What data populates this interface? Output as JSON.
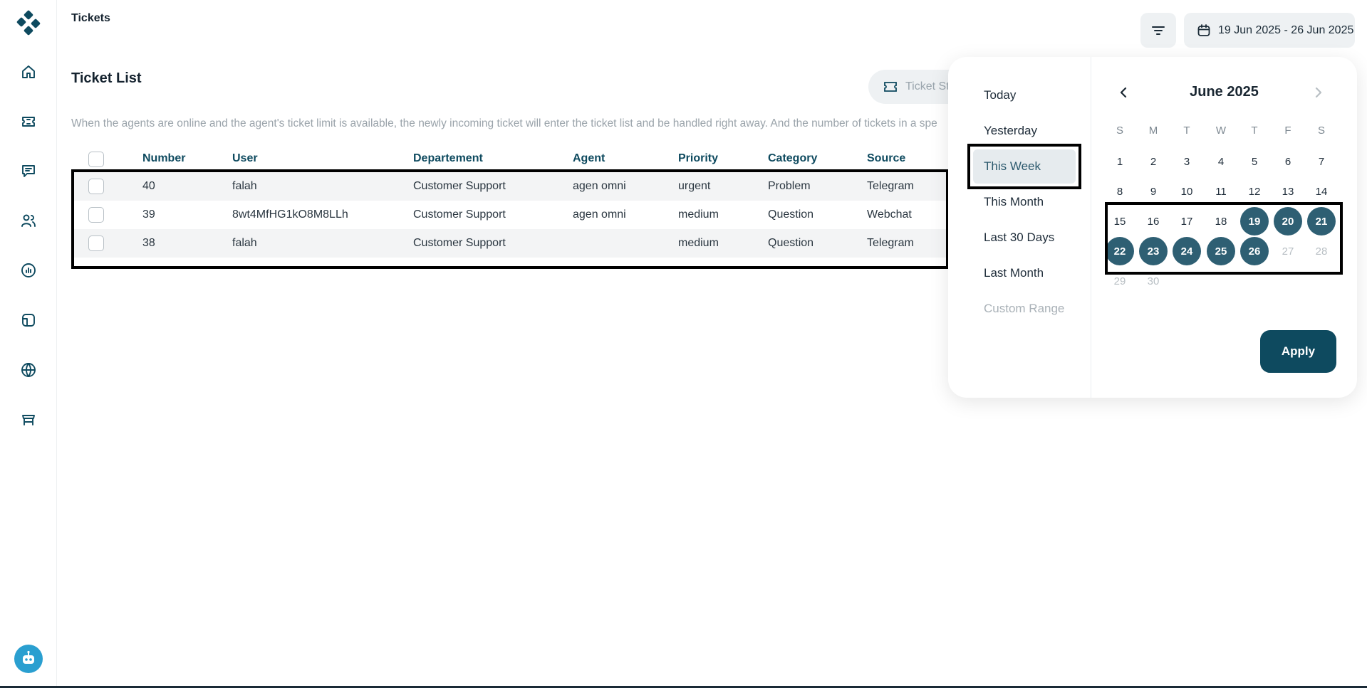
{
  "header": {
    "breadcrumb": "Tickets",
    "date_range": "19 Jun 2025 - 26 Jun 2025"
  },
  "main": {
    "title": "Ticket List",
    "ticket_status_button": "Ticket St",
    "description": "When the agents are online and the agent's ticket limit is available, the newly incoming ticket will enter the ticket list and be handled right away. And the number of tickets in a spe"
  },
  "table": {
    "columns": [
      "Number",
      "User",
      "Departement",
      "Agent",
      "Priority",
      "Category",
      "Source"
    ],
    "rows": [
      {
        "number": "40",
        "user": "falah",
        "department": "Customer Support",
        "agent": "agen omni",
        "priority": "urgent",
        "category": "Problem",
        "source": "Telegram"
      },
      {
        "number": "39",
        "user": "8wt4MfHG1kO8M8LLh",
        "department": "Customer Support",
        "agent": "agen omni",
        "priority": "medium",
        "category": "Question",
        "source": "Webchat"
      },
      {
        "number": "38",
        "user": "falah",
        "department": "Customer Support",
        "agent": "",
        "priority": "medium",
        "category": "Question",
        "source": "Telegram"
      }
    ]
  },
  "date_picker": {
    "presets": [
      "Today",
      "Yesterday",
      "This Week",
      "This Month",
      "Last 30 Days",
      "Last Month",
      "Custom Range"
    ],
    "active_preset": "This Week",
    "month": "June 2025",
    "weekdays": [
      "S",
      "M",
      "T",
      "W",
      "T",
      "F",
      "S"
    ],
    "weeks": [
      [
        "1",
        "2",
        "3",
        "4",
        "5",
        "6",
        "7"
      ],
      [
        "8",
        "9",
        "10",
        "11",
        "12",
        "13",
        "14"
      ],
      [
        "15",
        "16",
        "17",
        "18",
        "19",
        "20",
        "21"
      ],
      [
        "22",
        "23",
        "24",
        "25",
        "26",
        "27",
        "28"
      ],
      [
        "29",
        "30",
        "",
        "",
        "",
        "",
        ""
      ]
    ],
    "selected_days": [
      "19",
      "20",
      "21",
      "22",
      "23",
      "24",
      "25",
      "26"
    ],
    "apply_label": "Apply"
  },
  "colors": {
    "primary": "#0e4a5f",
    "selected_day": "#2e5f73",
    "header_text": "#0e4a5f"
  }
}
